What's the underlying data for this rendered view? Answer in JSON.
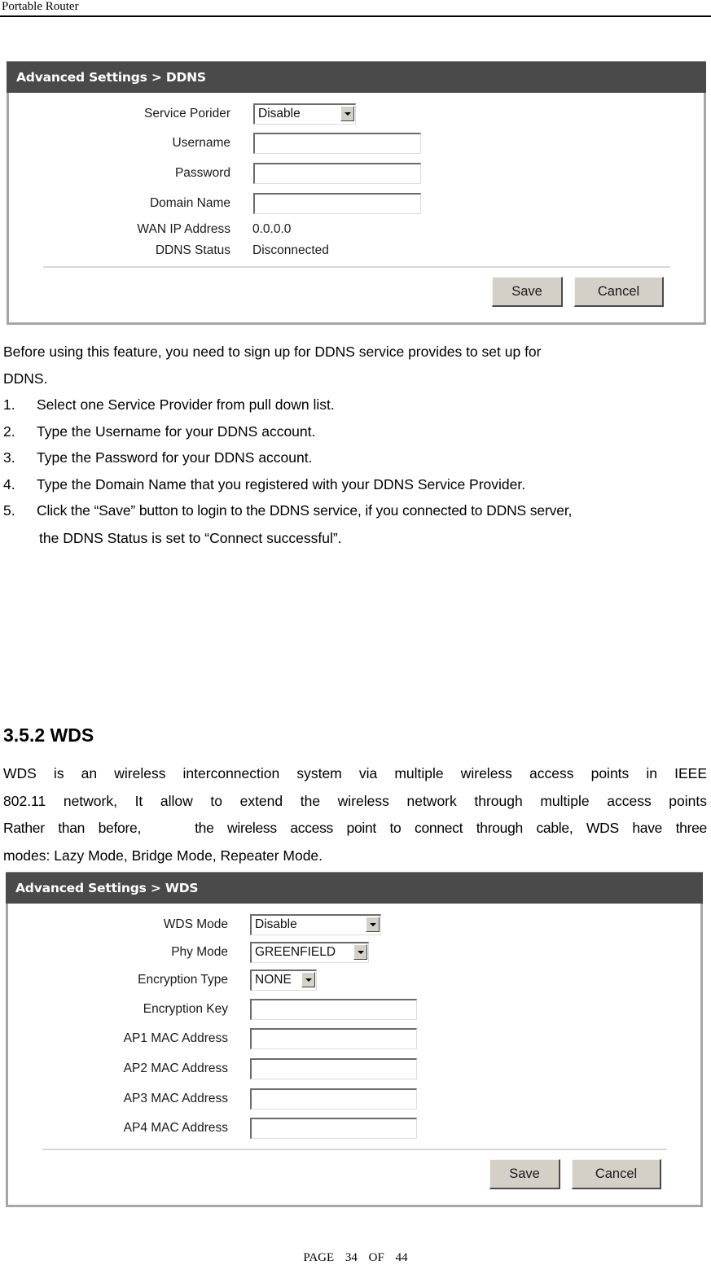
{
  "document": {
    "running_header": "Portable Router",
    "footer": {
      "label": "PAGE",
      "page": "34",
      "of": "OF",
      "total": "44"
    }
  },
  "ddns_panel": {
    "title": "Advanced Settings > DDNS",
    "fields": [
      {
        "label": "Service Porider",
        "type": "select",
        "value": "Disable"
      },
      {
        "label": "Username",
        "type": "text",
        "value": ""
      },
      {
        "label": "Password",
        "type": "text",
        "value": ""
      },
      {
        "label": "Domain Name",
        "type": "text",
        "value": ""
      },
      {
        "label": "WAN IP Address",
        "type": "readonly",
        "value": "0.0.0.0"
      },
      {
        "label": "DDNS Status",
        "type": "readonly",
        "value": "Disconnected"
      }
    ],
    "buttons": {
      "save": "Save",
      "cancel": "Cancel"
    }
  },
  "ddns_instructions": {
    "intro_line1": "Before using this feature, you need to sign up for DDNS service provides to set up for",
    "intro_line2": "DDNS.",
    "steps": [
      {
        "num": "1.",
        "text": "Select one Service Provider from pull down list."
      },
      {
        "num": "2.",
        "text": "Type the Username for your DDNS account."
      },
      {
        "num": "3.",
        "text": "Type the Password for your DDNS account."
      },
      {
        "num": "4.",
        "text": "Type the Domain Name that you registered with your DDNS Service Provider."
      },
      {
        "num": "5.",
        "text": "Click the “Save” button to login to the DDNS service, if you connected to DDNS server,",
        "continuation": "the DDNS Status is set to “Connect successful”."
      }
    ]
  },
  "wds_section": {
    "heading": "3.5.2 WDS",
    "paragraph_lines": [
      "WDS is an wireless interconnection system via multiple wireless access points in IEEE",
      "802.11 network, It allow to extend the wireless network through multiple access points",
      "Rather than before,    the wireless access point to connect through cable, WDS have three",
      "modes: Lazy Mode, Bridge Mode, Repeater Mode."
    ]
  },
  "wds_panel": {
    "title": "Advanced Settings > WDS",
    "fields": [
      {
        "label": "WDS Mode",
        "type": "select",
        "value": "Disable"
      },
      {
        "label": "Phy Mode",
        "type": "select",
        "value": "GREENFIELD"
      },
      {
        "label": "Encryption Type",
        "type": "select",
        "value": "NONE"
      },
      {
        "label": "Encryption Key",
        "type": "text",
        "value": ""
      },
      {
        "label": "AP1 MAC Address",
        "type": "text",
        "value": ""
      },
      {
        "label": "AP2 MAC Address",
        "type": "text",
        "value": ""
      },
      {
        "label": "AP3 MAC Address",
        "type": "text",
        "value": ""
      },
      {
        "label": "AP4 MAC Address",
        "type": "text",
        "value": ""
      }
    ],
    "buttons": {
      "save": "Save",
      "cancel": "Cancel"
    }
  },
  "colors": {
    "panel_title_bg": "#4a4a4a",
    "panel_border": "#a6a6a6",
    "button_face": "#d4d0c8"
  }
}
